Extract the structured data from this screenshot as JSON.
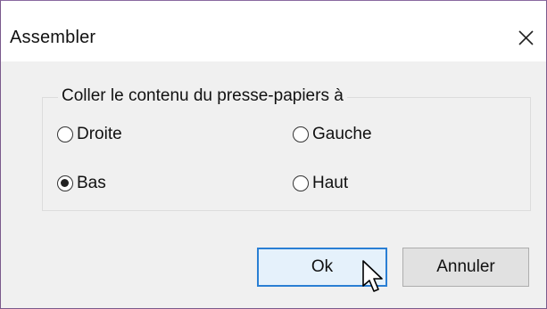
{
  "window": {
    "title": "Assembler",
    "close_icon": "close-icon"
  },
  "group": {
    "legend": "Coller le contenu du presse-papiers à",
    "options": [
      {
        "label": "Droite",
        "selected": false
      },
      {
        "label": "Gauche",
        "selected": false
      },
      {
        "label": "Bas",
        "selected": true
      },
      {
        "label": "Haut",
        "selected": false
      }
    ]
  },
  "buttons": {
    "ok_label": "Ok",
    "cancel_label": "Annuler"
  },
  "colors": {
    "window_border": "#7a5a8c",
    "ok_border": "#2a7fd4",
    "ok_bg": "#e5f1fb",
    "dialog_bg": "#f0f0f0"
  }
}
